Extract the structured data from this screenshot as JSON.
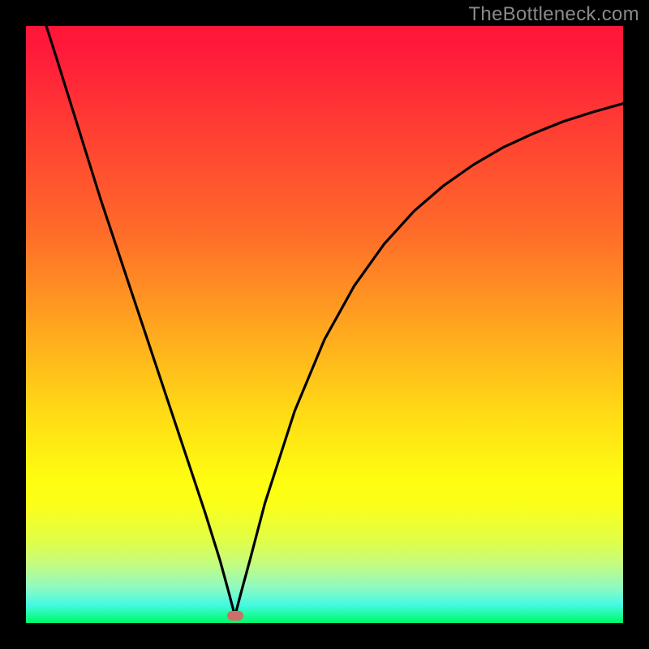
{
  "watermark": "TheBottleneck.com",
  "colors": {
    "frame_border": "#000000",
    "gradient_top": "#ff1637",
    "gradient_mid": "#ffdb15",
    "gradient_bottom": "#00fb68",
    "curve_stroke": "#000000",
    "marker": "#ca6f69"
  },
  "chart_data": {
    "type": "line",
    "title": "",
    "xlabel": "",
    "ylabel": "",
    "xlim": [
      0,
      100
    ],
    "ylim": [
      0,
      100
    ],
    "legend": false,
    "grid": false,
    "annotations": [
      {
        "type": "marker",
        "x": 35,
        "y": 1.2
      }
    ],
    "series": [
      {
        "name": "bottleneck-curve",
        "x": [
          3.4,
          5,
          7.5,
          10,
          12.5,
          15,
          17.5,
          20,
          22.5,
          25,
          27.5,
          30,
          32.5,
          34,
          35,
          36,
          37.5,
          40,
          45,
          50,
          55,
          60,
          65,
          70,
          75,
          80,
          85,
          90,
          95,
          100
        ],
        "values": [
          100,
          95,
          87,
          79,
          71,
          63.5,
          56,
          48.5,
          41,
          33.5,
          26,
          18.5,
          10.5,
          5,
          1.2,
          5,
          10.5,
          20,
          35.5,
          47.5,
          56.5,
          63.5,
          69,
          73.3,
          76.8,
          79.7,
          82,
          84,
          85.6,
          87
        ]
      }
    ]
  }
}
